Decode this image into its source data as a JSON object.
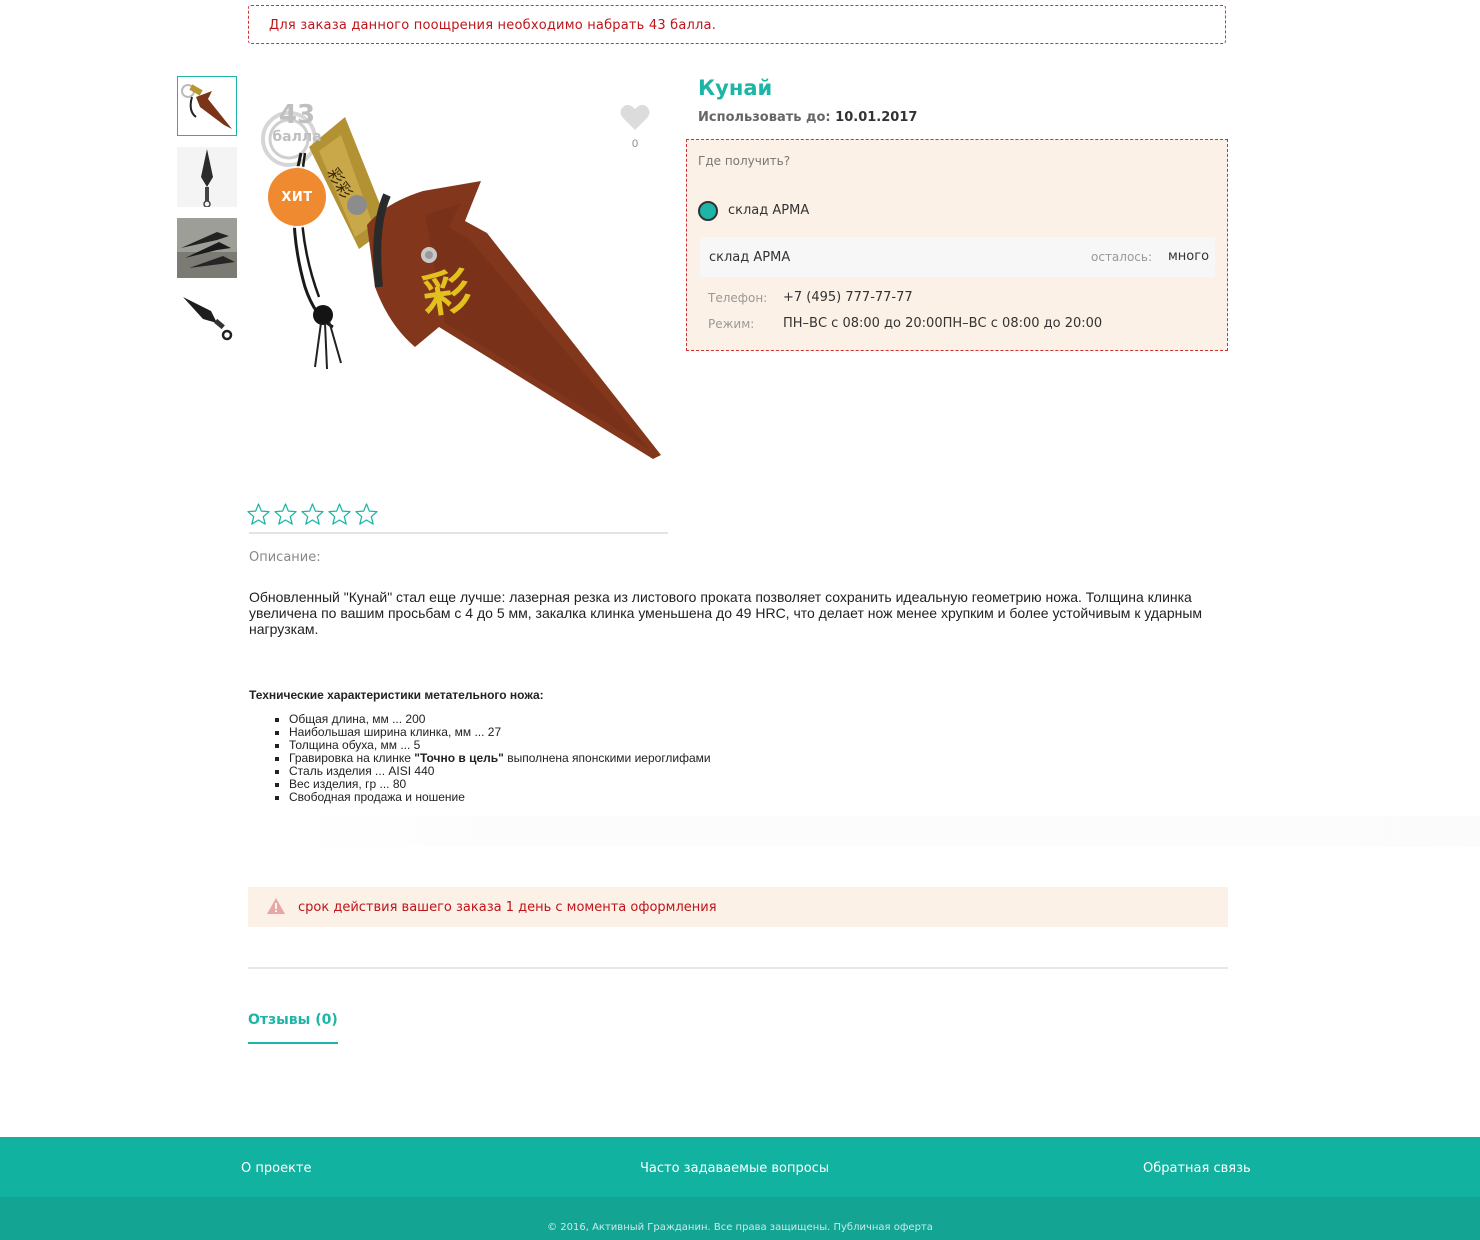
{
  "notice_top": "Для заказа данного поощрения необходимо набрать 43 балла.",
  "product": {
    "title": "Кунай",
    "use_until_label": "Использовать до:",
    "use_until_value": "10.01.2017",
    "points_number": "43",
    "points_unit": "балла",
    "badge": "ХИТ",
    "favorites_count": "0"
  },
  "pickup": {
    "question": "Где получить?",
    "option_label": "склад АРМА",
    "store_name": "склад АРМА",
    "remaining_label": "осталось:",
    "remaining_value": "много",
    "phone_label": "Телефон:",
    "phone_value": "+7 (495) 777-77-77",
    "hours_label": "Режим:",
    "hours_value": "ПН–ВС с 08:00 до 20:00ПН–ВС с 08:00 до 20:00"
  },
  "rating": {
    "max": 5,
    "value": 0
  },
  "description": {
    "label": "Описание:",
    "text": "Обновленный \"Кунай\" стал еще лучше: лазерная резка из листового проката позволяет сохранить идеальную геометрию ножа. Толщина клинка увеличена по вашим просьбам с 4 до 5 мм, закалка клинка уменьшена до 49 HRC, что делает нож менее хрупким и более устойчивым к ударным нагрузкам.",
    "spec_title": "Технические характеристики метательного ножа:",
    "specs": [
      "Общая длина, мм  ... 200",
      "Наибольшая ширина клинка, мм ... 27",
      "Толщина обуха, мм ... 5",
      "Гравировка на клинке ",
      "Сталь изделия ... AISI 440",
      "Вес изделия, гр ... 80",
      "Свободная продажа и ношение"
    ],
    "engraving_bold": "\"Точно в цель\"",
    "engraving_rest": " выполнена японскими иероглифами"
  },
  "warning": "срок действия вашего заказа 1 день с момента оформления",
  "tabs": {
    "reviews": "Отзывы (0)"
  },
  "footer": {
    "about": "О проекте",
    "faq": "Часто задаваемые вопросы",
    "feedback": "Обратная связь",
    "copyright": "© 2016, Активный Гражданин. Все права защищены. Публичная оферта"
  },
  "colors": {
    "accent": "#1cb5a6",
    "alert": "#c0141b",
    "badge": "#f08a30",
    "footer": "#11b2a0"
  },
  "icons": [
    "heart-icon",
    "star-icon",
    "warning-icon",
    "radio-icon"
  ]
}
